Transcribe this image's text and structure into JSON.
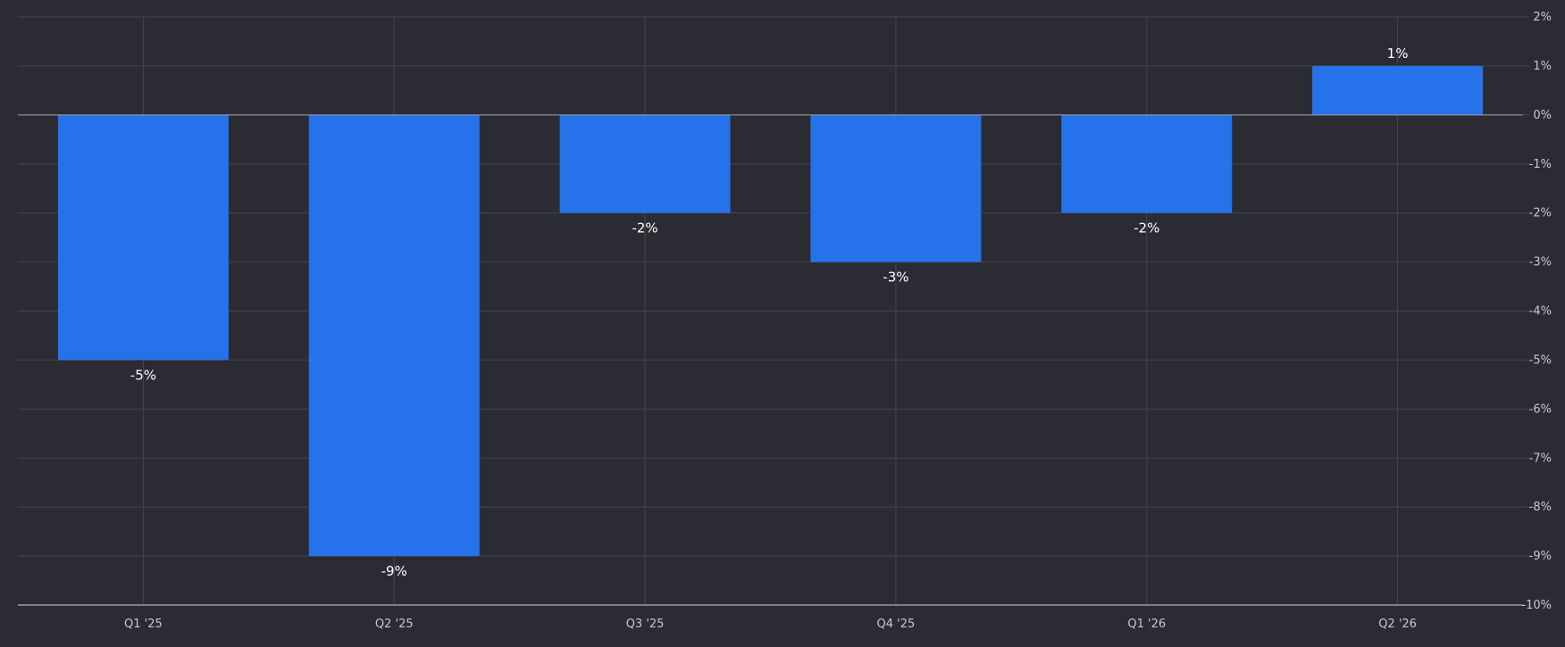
{
  "chart_data": {
    "type": "bar",
    "categories": [
      "Q1 '25",
      "Q2 '25",
      "Q3 '25",
      "Q4 '25",
      "Q1 '26",
      "Q2 '26"
    ],
    "values": [
      -5,
      -9,
      -2,
      -3,
      -2,
      1
    ],
    "data_labels": [
      "-5%",
      "-9%",
      "-2%",
      "-3%",
      "-2%",
      "1%"
    ],
    "ylim": [
      -10,
      2
    ],
    "y_ticks": [
      2,
      1,
      0,
      -1,
      -2,
      -3,
      -4,
      -5,
      -6,
      -7,
      -8,
      -9,
      -10
    ],
    "y_tick_labels": [
      "2%",
      "1%",
      "0%",
      "-1%",
      "-2%",
      "-3%",
      "-4%",
      "-5%",
      "-6%",
      "-7%",
      "-8%",
      "-9%",
      "-10%"
    ],
    "y_axis_side": "right",
    "grid": true,
    "legend": "none",
    "title": "",
    "xlabel": "",
    "ylabel": "",
    "colors": {
      "bar": "#2672ea",
      "background": "#2b2b34",
      "grid": "#45454f",
      "axis": "#9a9aa5",
      "tick_text": "#c8c8d0",
      "label_text": "#ffffff"
    }
  }
}
